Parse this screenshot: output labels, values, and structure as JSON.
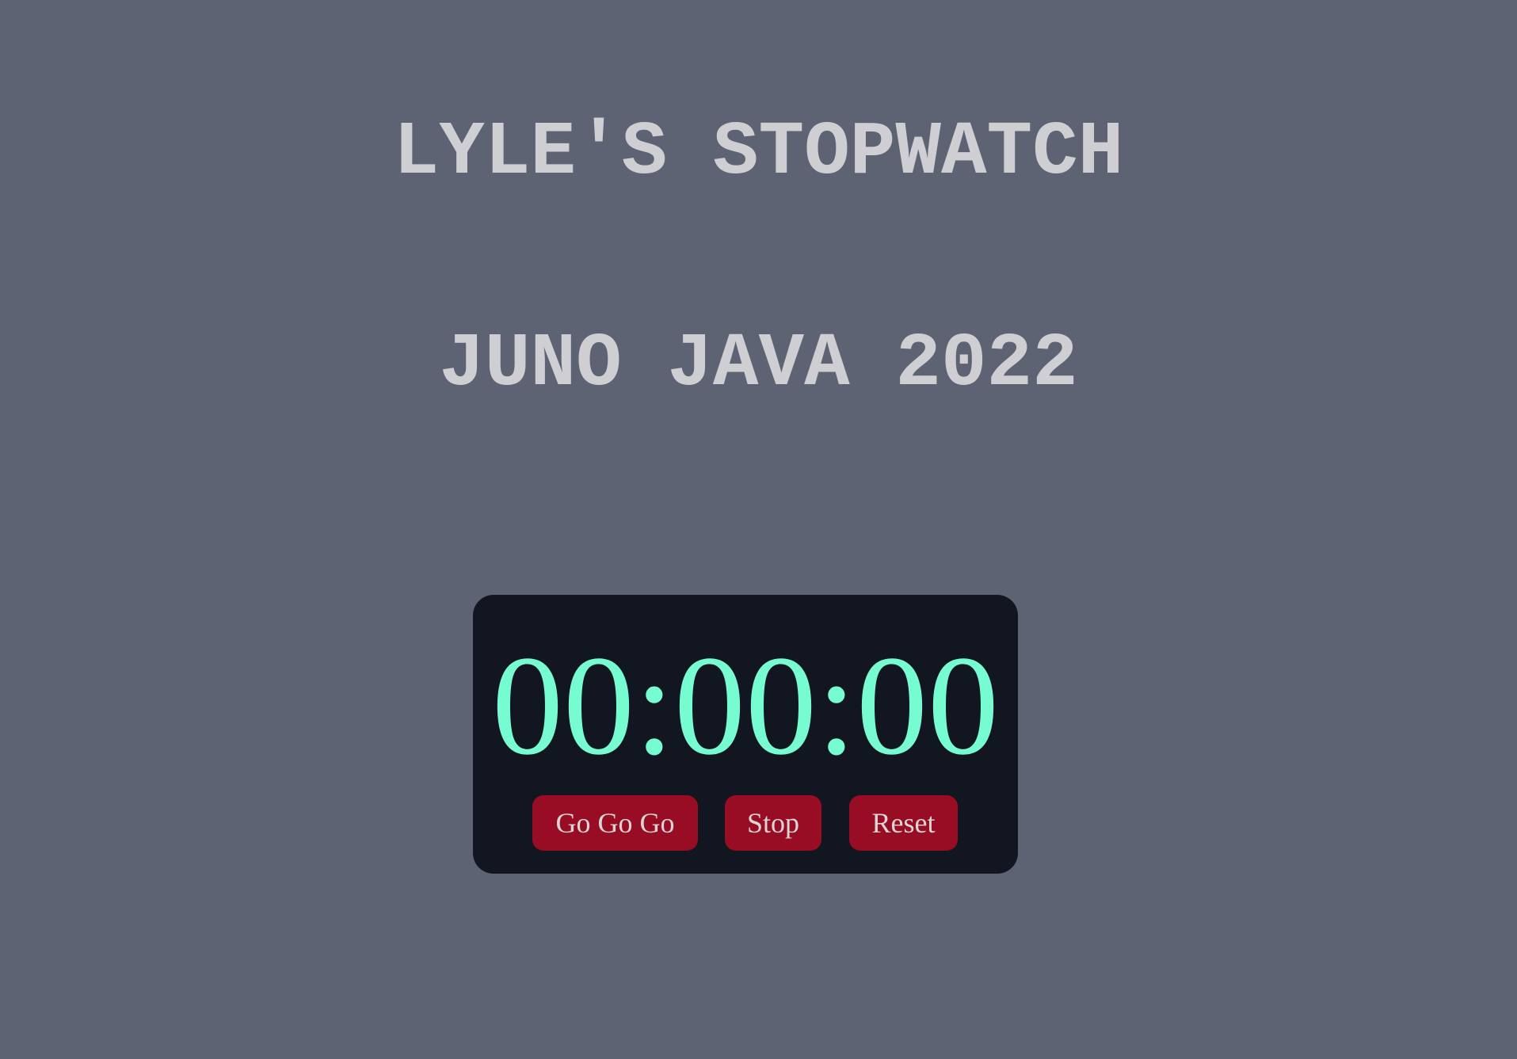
{
  "header": {
    "title": "LYLE'S STOPWATCH",
    "subtitle": "JUNO JAVA 2022"
  },
  "stopwatch": {
    "display": "00:00:00",
    "buttons": {
      "start_label": "Go Go Go",
      "stop_label": "Stop",
      "reset_label": "Reset"
    }
  },
  "colors": {
    "page_background": "#5d6372",
    "title_text": "#cfcfd3",
    "panel_background": "#121620",
    "display_text": "#77fcd2",
    "button_background": "#990d24",
    "button_text": "#d9d4d6"
  }
}
